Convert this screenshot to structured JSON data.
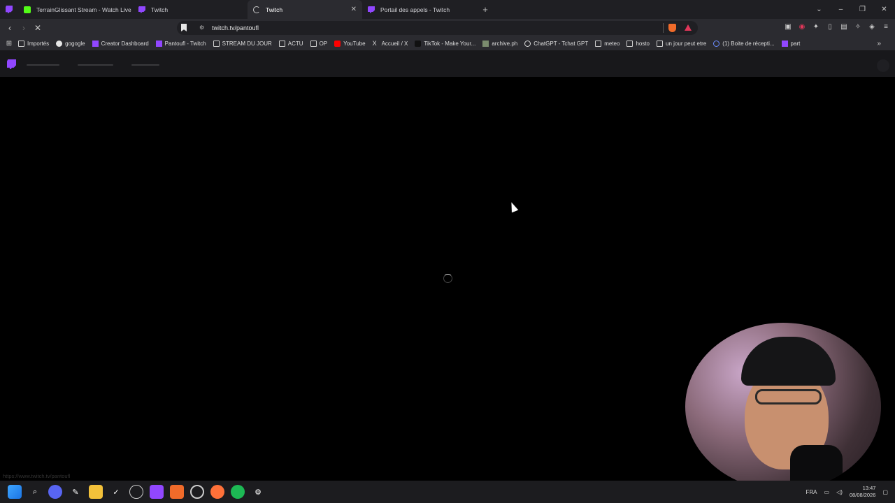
{
  "tabs": [
    {
      "title": "TerrainGlissant Stream - Watch Live o",
      "favicon": "kick-icon",
      "color": "#53fc18"
    },
    {
      "title": "Twitch",
      "favicon": "twitch-icon",
      "color": "#9147ff"
    },
    {
      "title": "Twitch",
      "favicon": "loading-icon",
      "color": "#cccccc",
      "active": true,
      "close": "✕"
    },
    {
      "title": "Portail des appels - Twitch",
      "favicon": "twitch-icon",
      "color": "#9147ff"
    }
  ],
  "new_tab": "+",
  "address_bar": {
    "url": "twitch.tv/pantoufl"
  },
  "bookmarks": [
    {
      "label": "Importés",
      "icon": "folder-icon"
    },
    {
      "label": "gogogle",
      "icon": "google-icon"
    },
    {
      "label": "Creator Dashboard",
      "icon": "twitch-icon"
    },
    {
      "label": "Pantoufl - Twitch",
      "icon": "twitch-icon"
    },
    {
      "label": "STREAM DU JOUR",
      "icon": "folder-icon"
    },
    {
      "label": "ACTU",
      "icon": "folder-icon"
    },
    {
      "label": "OP",
      "icon": "folder-icon"
    },
    {
      "label": "YouTube",
      "icon": "youtube-icon"
    },
    {
      "label": "Accueil / X",
      "icon": "x-icon"
    },
    {
      "label": "TikTok - Make Your...",
      "icon": "tiktok-icon"
    },
    {
      "label": "archive.ph",
      "icon": "archive-icon"
    },
    {
      "label": "ChatGPT - Tchat GPT",
      "icon": "chatgpt-icon"
    },
    {
      "label": "meteo",
      "icon": "folder-icon"
    },
    {
      "label": "hosto",
      "icon": "folder-icon"
    },
    {
      "label": "un jour peut etre",
      "icon": "folder-icon"
    },
    {
      "label": "(1) Boite de récepti...",
      "icon": "mail-icon"
    },
    {
      "label": "part",
      "icon": "twitch-icon"
    }
  ],
  "status_bar": {
    "url": "https://www.twitch.tv/pantoufl"
  },
  "taskbar": {
    "language": "FRA",
    "time": "13:47",
    "date": "08/08/2026"
  }
}
